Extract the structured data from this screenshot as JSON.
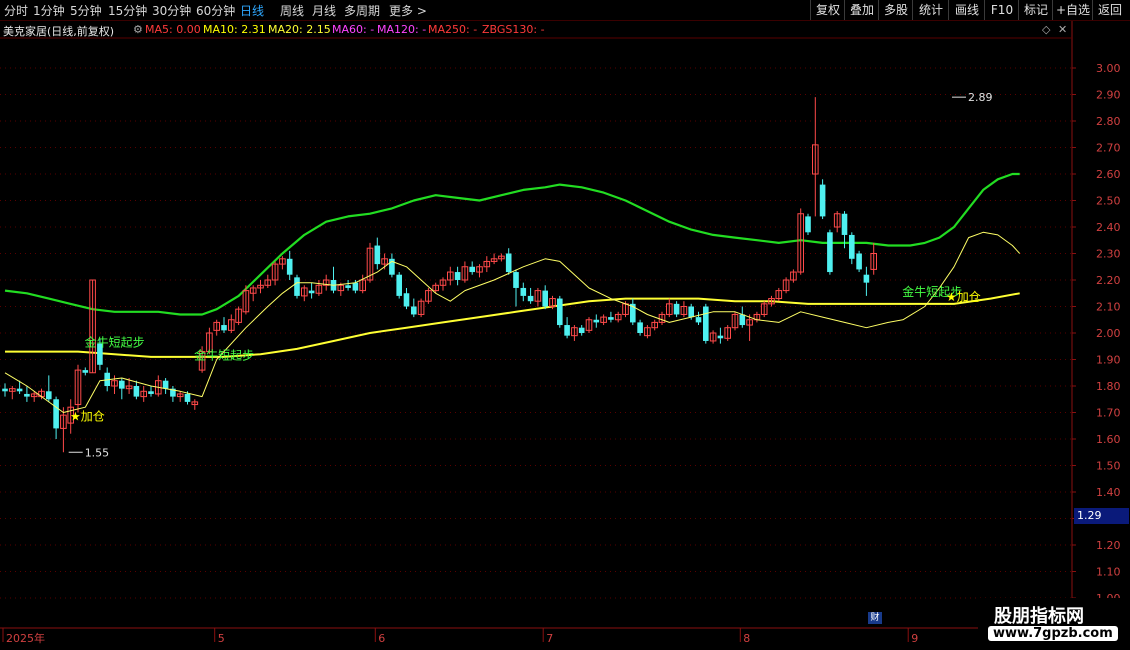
{
  "periods": [
    "分时",
    "1分钟",
    "5分钟",
    "15分钟",
    "30分钟",
    "60分钟",
    "日线",
    "周线",
    "月线",
    "多周期",
    "更多"
  ],
  "active_period": "日线",
  "more_chevron": ">",
  "right_buttons": [
    "复权",
    "叠加",
    "多股",
    "统计",
    "画线",
    "F10",
    "标记",
    "+自选",
    "返回"
  ],
  "stock_title": "美克家居(日线,前复权)",
  "ma_items": [
    {
      "label": "MA5: 0.00",
      "color": "#ff3a3a"
    },
    {
      "label": "MA10: 2.31",
      "color": "#ffff00"
    },
    {
      "label": "MA20: 2.15",
      "color": "#ffff33"
    },
    {
      "label": "MA60: -",
      "color": "#ff44ff"
    },
    {
      "label": "MA120: -",
      "color": "#ff44ff"
    },
    {
      "label": "MA250: -",
      "color": "#ff3a3a"
    },
    {
      "label": "ZBGS130: -",
      "color": "#ff3a3a"
    }
  ],
  "current_price": "1.29",
  "cai_icon": "财",
  "watermark": {
    "title": "股朋指标网",
    "url": "www.7gpzb.com"
  },
  "chart_data": {
    "type": "candlestick",
    "ylim": [
      0.9,
      3.0
    ],
    "y_ticks": [
      "3.00",
      "2.90",
      "2.80",
      "2.70",
      "2.60",
      "2.50",
      "2.40",
      "2.30",
      "2.20",
      "2.10",
      "2.00",
      "1.90",
      "1.80",
      "1.70",
      "1.60",
      "1.50",
      "1.40",
      "1.30",
      "1.20",
      "1.10",
      "1.00"
    ],
    "x_labels": [
      "2025年",
      "5",
      "6",
      "7",
      "8",
      "9"
    ],
    "x_label_day_index": [
      0,
      29,
      51,
      74,
      101,
      124
    ],
    "candles": [
      [
        1.79,
        1.81,
        1.76,
        1.78
      ],
      [
        1.78,
        1.8,
        1.75,
        1.79
      ],
      [
        1.79,
        1.82,
        1.77,
        1.78
      ],
      [
        1.77,
        1.8,
        1.74,
        1.76
      ],
      [
        1.76,
        1.78,
        1.74,
        1.77
      ],
      [
        1.76,
        1.79,
        1.75,
        1.78
      ],
      [
        1.78,
        1.84,
        1.74,
        1.75
      ],
      [
        1.75,
        1.76,
        1.6,
        1.64
      ],
      [
        1.64,
        1.72,
        1.55,
        1.69
      ],
      [
        1.66,
        1.75,
        1.62,
        1.72
      ],
      [
        1.73,
        1.88,
        1.7,
        1.86
      ],
      [
        1.86,
        1.87,
        1.84,
        1.85
      ],
      [
        1.85,
        2.2,
        1.85,
        2.2
      ],
      [
        1.96,
        1.98,
        1.86,
        1.88
      ],
      [
        1.85,
        1.87,
        1.78,
        1.8
      ],
      [
        1.8,
        1.84,
        1.77,
        1.82
      ],
      [
        1.82,
        1.83,
        1.75,
        1.79
      ],
      [
        1.79,
        1.83,
        1.77,
        1.8
      ],
      [
        1.8,
        1.82,
        1.75,
        1.76
      ],
      [
        1.76,
        1.8,
        1.74,
        1.78
      ],
      [
        1.78,
        1.8,
        1.76,
        1.77
      ],
      [
        1.77,
        1.84,
        1.76,
        1.82
      ],
      [
        1.82,
        1.83,
        1.77,
        1.79
      ],
      [
        1.79,
        1.8,
        1.74,
        1.76
      ],
      [
        1.76,
        1.78,
        1.74,
        1.77
      ],
      [
        1.77,
        1.78,
        1.73,
        1.74
      ],
      [
        1.73,
        1.75,
        1.71,
        1.74
      ],
      [
        1.86,
        1.95,
        1.85,
        1.93
      ],
      [
        1.93,
        2.02,
        1.92,
        2.0
      ],
      [
        2.01,
        2.05,
        1.99,
        2.04
      ],
      [
        2.03,
        2.06,
        2.0,
        2.01
      ],
      [
        2.01,
        2.07,
        2.0,
        2.05
      ],
      [
        2.04,
        2.1,
        2.03,
        2.09
      ],
      [
        2.08,
        2.18,
        2.07,
        2.16
      ],
      [
        2.15,
        2.18,
        2.12,
        2.17
      ],
      [
        2.17,
        2.2,
        2.15,
        2.18
      ],
      [
        2.18,
        2.22,
        2.17,
        2.2
      ],
      [
        2.2,
        2.27,
        2.18,
        2.26
      ],
      [
        2.26,
        2.29,
        2.24,
        2.28
      ],
      [
        2.28,
        2.31,
        2.2,
        2.22
      ],
      [
        2.21,
        2.22,
        2.13,
        2.14
      ],
      [
        2.14,
        2.18,
        2.12,
        2.17
      ],
      [
        2.16,
        2.19,
        2.13,
        2.15
      ],
      [
        2.15,
        2.2,
        2.14,
        2.18
      ],
      [
        2.18,
        2.22,
        2.16,
        2.2
      ],
      [
        2.2,
        2.25,
        2.15,
        2.16
      ],
      [
        2.16,
        2.19,
        2.14,
        2.18
      ],
      [
        2.18,
        2.2,
        2.16,
        2.17
      ],
      [
        2.19,
        2.2,
        2.15,
        2.16
      ],
      [
        2.16,
        2.22,
        2.15,
        2.2
      ],
      [
        2.2,
        2.34,
        2.19,
        2.32
      ],
      [
        2.33,
        2.36,
        2.24,
        2.26
      ],
      [
        2.26,
        2.3,
        2.24,
        2.28
      ],
      [
        2.28,
        2.3,
        2.21,
        2.22
      ],
      [
        2.22,
        2.23,
        2.13,
        2.14
      ],
      [
        2.15,
        2.17,
        2.09,
        2.1
      ],
      [
        2.1,
        2.13,
        2.06,
        2.07
      ],
      [
        2.07,
        2.13,
        2.06,
        2.12
      ],
      [
        2.12,
        2.17,
        2.11,
        2.16
      ],
      [
        2.16,
        2.19,
        2.15,
        2.18
      ],
      [
        2.18,
        2.21,
        2.16,
        2.2
      ],
      [
        2.2,
        2.25,
        2.18,
        2.23
      ],
      [
        2.23,
        2.25,
        2.18,
        2.2
      ],
      [
        2.2,
        2.27,
        2.19,
        2.25
      ],
      [
        2.25,
        2.27,
        2.22,
        2.23
      ],
      [
        2.23,
        2.26,
        2.21,
        2.25
      ],
      [
        2.25,
        2.29,
        2.23,
        2.27
      ],
      [
        2.27,
        2.3,
        2.26,
        2.28
      ],
      [
        2.28,
        2.3,
        2.27,
        2.29
      ],
      [
        2.3,
        2.32,
        2.22,
        2.23
      ],
      [
        2.23,
        2.24,
        2.1,
        2.17
      ],
      [
        2.17,
        2.19,
        2.12,
        2.14
      ],
      [
        2.14,
        2.17,
        2.11,
        2.12
      ],
      [
        2.12,
        2.17,
        2.1,
        2.16
      ],
      [
        2.16,
        2.18,
        2.09,
        2.1
      ],
      [
        2.1,
        2.14,
        2.09,
        2.13
      ],
      [
        2.13,
        2.14,
        2.02,
        2.03
      ],
      [
        2.03,
        2.06,
        1.98,
        1.99
      ],
      [
        1.99,
        2.03,
        1.97,
        2.02
      ],
      [
        2.02,
        2.03,
        1.99,
        2.0
      ],
      [
        2.01,
        2.06,
        2.0,
        2.05
      ],
      [
        2.05,
        2.07,
        2.02,
        2.04
      ],
      [
        2.04,
        2.07,
        2.03,
        2.06
      ],
      [
        2.06,
        2.08,
        2.04,
        2.05
      ],
      [
        2.05,
        2.08,
        2.04,
        2.07
      ],
      [
        2.07,
        2.12,
        2.06,
        2.11
      ],
      [
        2.11,
        2.13,
        2.03,
        2.04
      ],
      [
        2.04,
        2.05,
        1.99,
        2.0
      ],
      [
        1.99,
        2.03,
        1.98,
        2.02
      ],
      [
        2.02,
        2.05,
        2.01,
        2.04
      ],
      [
        2.04,
        2.08,
        2.03,
        2.07
      ],
      [
        2.07,
        2.13,
        2.06,
        2.11
      ],
      [
        2.11,
        2.12,
        2.06,
        2.07
      ],
      [
        2.07,
        2.12,
        2.06,
        2.1
      ],
      [
        2.1,
        2.11,
        2.05,
        2.06
      ],
      [
        2.06,
        2.08,
        2.03,
        2.04
      ],
      [
        2.1,
        2.11,
        1.96,
        1.97
      ],
      [
        1.97,
        2.01,
        1.96,
        2.0
      ],
      [
        1.99,
        2.02,
        1.96,
        1.98
      ],
      [
        1.98,
        2.03,
        1.97,
        2.02
      ],
      [
        2.02,
        2.08,
        2.01,
        2.07
      ],
      [
        2.07,
        2.1,
        2.02,
        2.03
      ],
      [
        2.03,
        2.07,
        1.97,
        2.05
      ],
      [
        2.05,
        2.08,
        2.04,
        2.07
      ],
      [
        2.07,
        2.12,
        2.06,
        2.11
      ],
      [
        2.11,
        2.14,
        2.1,
        2.13
      ],
      [
        2.13,
        2.17,
        2.12,
        2.16
      ],
      [
        2.16,
        2.21,
        2.15,
        2.2
      ],
      [
        2.2,
        2.24,
        2.19,
        2.23
      ],
      [
        2.23,
        2.47,
        2.22,
        2.45
      ],
      [
        2.44,
        2.45,
        2.37,
        2.38
      ],
      [
        2.6,
        2.89,
        2.44,
        2.71
      ],
      [
        2.56,
        2.58,
        2.43,
        2.44
      ],
      [
        2.38,
        2.39,
        2.22,
        2.23
      ],
      [
        2.4,
        2.46,
        2.38,
        2.45
      ],
      [
        2.45,
        2.46,
        2.32,
        2.37
      ],
      [
        2.37,
        2.38,
        2.26,
        2.28
      ],
      [
        2.3,
        2.31,
        2.23,
        2.24
      ],
      [
        2.22,
        2.25,
        2.14,
        2.19
      ],
      [
        2.24,
        2.34,
        2.22,
        2.3
      ]
    ],
    "ma_yellow_curve": [
      [
        0,
        1.85
      ],
      [
        3,
        1.8
      ],
      [
        6,
        1.74
      ],
      [
        8,
        1.7
      ],
      [
        11,
        1.72
      ],
      [
        13,
        1.82
      ],
      [
        16,
        1.83
      ],
      [
        20,
        1.8
      ],
      [
        24,
        1.78
      ],
      [
        27,
        1.76
      ],
      [
        29,
        1.9
      ],
      [
        33,
        2.02
      ],
      [
        36,
        2.1
      ],
      [
        38,
        2.15
      ],
      [
        40,
        2.19
      ],
      [
        42,
        2.19
      ],
      [
        45,
        2.18
      ],
      [
        48,
        2.19
      ],
      [
        51,
        2.23
      ],
      [
        53,
        2.27
      ],
      [
        55,
        2.25
      ],
      [
        57,
        2.2
      ],
      [
        59,
        2.15
      ],
      [
        61,
        2.12
      ],
      [
        63,
        2.16
      ],
      [
        67,
        2.2
      ],
      [
        71,
        2.25
      ],
      [
        74,
        2.28
      ],
      [
        76,
        2.27
      ],
      [
        80,
        2.17
      ],
      [
        83,
        2.13
      ],
      [
        86,
        2.1
      ],
      [
        88,
        2.07
      ],
      [
        91,
        2.04
      ],
      [
        94,
        2.06
      ],
      [
        97,
        2.08
      ],
      [
        100,
        2.08
      ],
      [
        103,
        2.05
      ],
      [
        106,
        2.04
      ],
      [
        109,
        2.08
      ],
      [
        112,
        2.06
      ],
      [
        115,
        2.04
      ],
      [
        118,
        2.02
      ],
      [
        121,
        2.04
      ],
      [
        123,
        2.05
      ],
      [
        126,
        2.1
      ],
      [
        128,
        2.17
      ],
      [
        130,
        2.25
      ],
      [
        132,
        2.36
      ],
      [
        134,
        2.38
      ],
      [
        136,
        2.37
      ],
      [
        138,
        2.33
      ],
      [
        139,
        2.3
      ]
    ],
    "green_band": [
      [
        0,
        2.16
      ],
      [
        3,
        2.15
      ],
      [
        6,
        2.13
      ],
      [
        9,
        2.11
      ],
      [
        12,
        2.09
      ],
      [
        15,
        2.08
      ],
      [
        18,
        2.08
      ],
      [
        21,
        2.08
      ],
      [
        24,
        2.07
      ],
      [
        27,
        2.07
      ],
      [
        29,
        2.09
      ],
      [
        32,
        2.14
      ],
      [
        35,
        2.22
      ],
      [
        38,
        2.3
      ],
      [
        41,
        2.37
      ],
      [
        44,
        2.42
      ],
      [
        47,
        2.44
      ],
      [
        50,
        2.45
      ],
      [
        53,
        2.47
      ],
      [
        56,
        2.5
      ],
      [
        59,
        2.52
      ],
      [
        62,
        2.51
      ],
      [
        65,
        2.5
      ],
      [
        68,
        2.52
      ],
      [
        71,
        2.54
      ],
      [
        74,
        2.55
      ],
      [
        76,
        2.56
      ],
      [
        79,
        2.55
      ],
      [
        82,
        2.53
      ],
      [
        85,
        2.5
      ],
      [
        88,
        2.46
      ],
      [
        91,
        2.42
      ],
      [
        94,
        2.39
      ],
      [
        97,
        2.37
      ],
      [
        100,
        2.36
      ],
      [
        103,
        2.35
      ],
      [
        106,
        2.34
      ],
      [
        109,
        2.35
      ],
      [
        112,
        2.34
      ],
      [
        115,
        2.34
      ],
      [
        118,
        2.34
      ],
      [
        121,
        2.33
      ],
      [
        124,
        2.33
      ],
      [
        126,
        2.34
      ],
      [
        128,
        2.36
      ],
      [
        130,
        2.4
      ],
      [
        132,
        2.47
      ],
      [
        134,
        2.54
      ],
      [
        136,
        2.58
      ],
      [
        138,
        2.6
      ],
      [
        139,
        2.6
      ]
    ],
    "ma_thick_yellow": [
      [
        0,
        1.93
      ],
      [
        5,
        1.93
      ],
      [
        10,
        1.93
      ],
      [
        15,
        1.92
      ],
      [
        20,
        1.91
      ],
      [
        25,
        1.91
      ],
      [
        30,
        1.91
      ],
      [
        35,
        1.92
      ],
      [
        40,
        1.94
      ],
      [
        45,
        1.97
      ],
      [
        50,
        2.0
      ],
      [
        55,
        2.02
      ],
      [
        60,
        2.04
      ],
      [
        65,
        2.06
      ],
      [
        70,
        2.08
      ],
      [
        75,
        2.1
      ],
      [
        80,
        2.12
      ],
      [
        85,
        2.13
      ],
      [
        90,
        2.13
      ],
      [
        95,
        2.13
      ],
      [
        100,
        2.12
      ],
      [
        105,
        2.12
      ],
      [
        110,
        2.11
      ],
      [
        115,
        2.11
      ],
      [
        120,
        2.11
      ],
      [
        125,
        2.11
      ],
      [
        130,
        2.11
      ],
      [
        135,
        2.13
      ],
      [
        139,
        2.15
      ]
    ],
    "annotations": [
      {
        "text": "金牛短起步",
        "day": 12,
        "price": 1.95,
        "color": "#44ff44"
      },
      {
        "text": "金牛短起步",
        "day": 27,
        "price": 1.9,
        "color": "#44ff44"
      },
      {
        "text": "金牛短起步",
        "day": 124,
        "price": 2.14,
        "color": "#44ff44"
      },
      {
        "text": "★加仓",
        "day": 10,
        "price": 1.67,
        "color": "#ffff00"
      },
      {
        "text": "★加仓",
        "day": 130,
        "price": 2.12,
        "color": "#ffff00"
      },
      {
        "text": "1.55",
        "day": 9,
        "price": 1.55,
        "color": "#e0e0e0",
        "marker": "low"
      },
      {
        "text": "2.89",
        "day": 130,
        "price": 2.89,
        "color": "#e0e0e0",
        "marker": "high"
      }
    ]
  }
}
